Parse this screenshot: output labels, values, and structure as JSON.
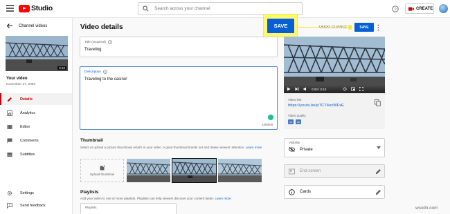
{
  "header": {
    "logo_text": "Studio",
    "search_placeholder": "Search across your channel",
    "create_label": "CREATE"
  },
  "sidebar": {
    "back_label": "Channel videos",
    "thumb_duration": "0:10",
    "your_video_label": "Your video",
    "video_date": "November 27, 2020",
    "items": [
      {
        "label": "Details",
        "icon": "pencil-icon",
        "active": true
      },
      {
        "label": "Analytics",
        "icon": "analytics-icon"
      },
      {
        "label": "Editor",
        "icon": "film-editor-icon"
      },
      {
        "label": "Comments",
        "icon": "comments-icon"
      },
      {
        "label": "Subtitles",
        "icon": "subtitles-icon"
      }
    ],
    "settings_label": "Settings",
    "feedback_label": "Send feedback"
  },
  "main": {
    "title": "Video details",
    "undo_label": "UNDO CHANGES",
    "save_label": "SAVE",
    "callout_save_label": "SAVE",
    "title_field": {
      "label": "Title (required)",
      "value": "Traveling"
    },
    "description_field": {
      "label": "Description",
      "value": "Traveling to the casino!",
      "count": "24/5000"
    },
    "thumbnail": {
      "heading": "Thumbnail",
      "desc": "Select or upload a picture that shows what's in your video. A good thumbnail stands out and draws viewers' attention.",
      "learn_more": "Learn more",
      "upload_label": "Upload thumbnail"
    },
    "playlists": {
      "heading": "Playlists",
      "desc": "Add your video to one or more playlists. Playlists can help viewers discover your content faster.",
      "learn_more": "Learn more",
      "field_label": "Playlists"
    }
  },
  "preview": {
    "time": "0:00 / 0:10",
    "link_label": "Video link",
    "link": "https://youtu.be/pTCT4oxWFxE",
    "quality_label": "Video quality",
    "quality_badges": [
      "SD",
      "HD"
    ]
  },
  "visibility": {
    "label": "Visibility",
    "value": "Private"
  },
  "end_screen_label": "End screen",
  "cards_label": "Cards",
  "watermark": "wsxdn.com",
  "colors": {
    "accent": "#065fd4",
    "brand_red": "#ff0000",
    "callout_yellow": "#fff873",
    "active_red": "#cc0000"
  }
}
